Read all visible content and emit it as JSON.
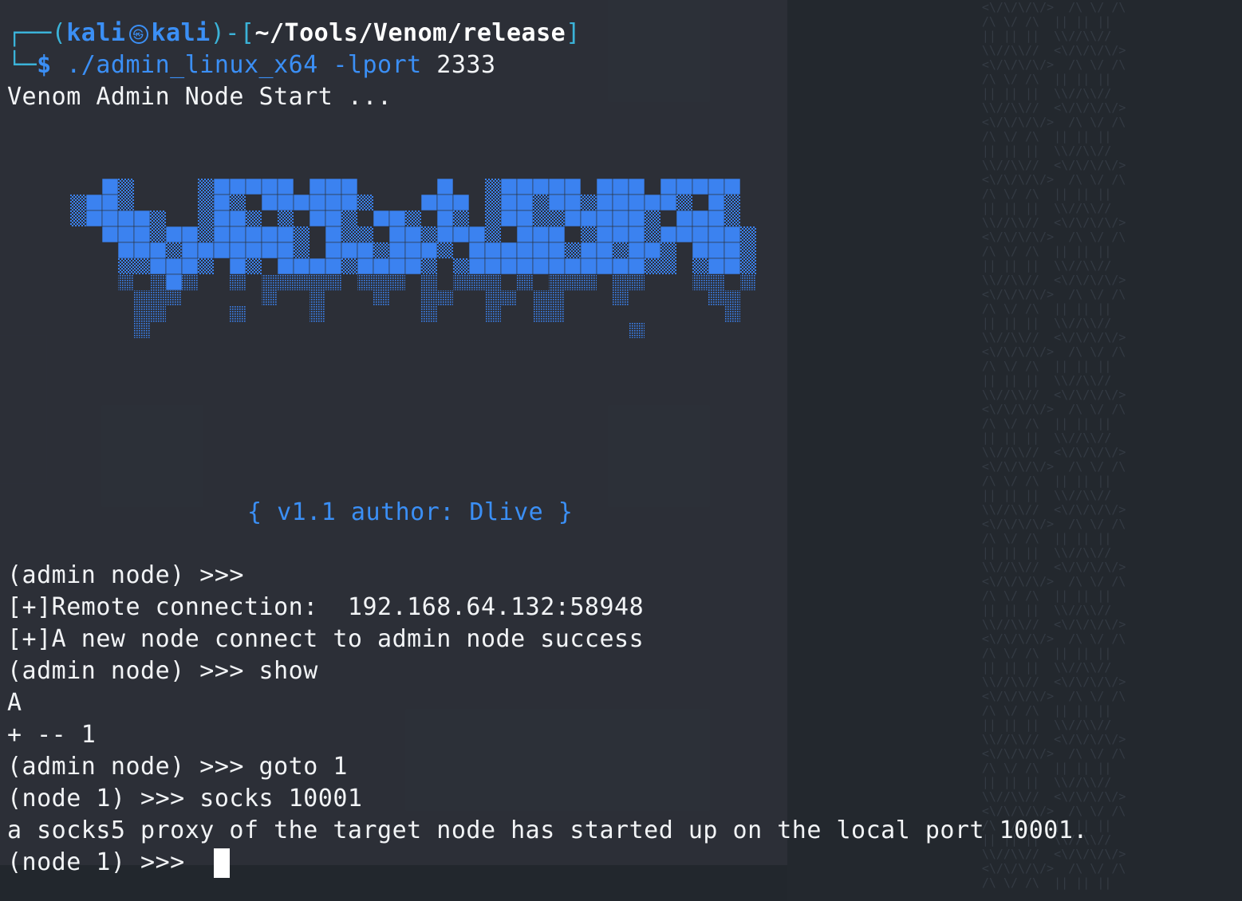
{
  "prompt": {
    "frame_open": "┌──(",
    "user": "kali",
    "icon": "kali-dragon-icon",
    "host": "kali",
    "frame_mid": ")-[",
    "path": "~/Tools/Venom/release",
    "frame_close": "]",
    "frame_bottom": "└─",
    "dollar": "$",
    "command": "./admin_linux_x64",
    "flag": "-lport",
    "arg": "2333"
  },
  "output": {
    "start_line": "Venom Admin Node Start ...",
    "version_line": "{ v1.1 author: Dlive }",
    "lines": [
      "(admin node) >>>",
      "[+]Remote connection:  192.168.64.132:58948",
      "[+]A new node connect to admin node success",
      "(admin node) >>> show",
      "A",
      "+ -- 1",
      "(admin node) >>> goto 1",
      "(node 1) >>> socks 10001",
      "a socks5 proxy of the target node has started up on the local port 10001.",
      "(node 1) >>> "
    ]
  },
  "logo": {
    "text": "VENOM",
    "colors": {
      "solid": "#3b82f0",
      "dither": "#3b82f0",
      "grid": "#2c3038"
    }
  },
  "colors": {
    "terminal_bg": "#2c3038",
    "accent_blue": "#3b8ff5",
    "text": "#f2f4f6"
  }
}
